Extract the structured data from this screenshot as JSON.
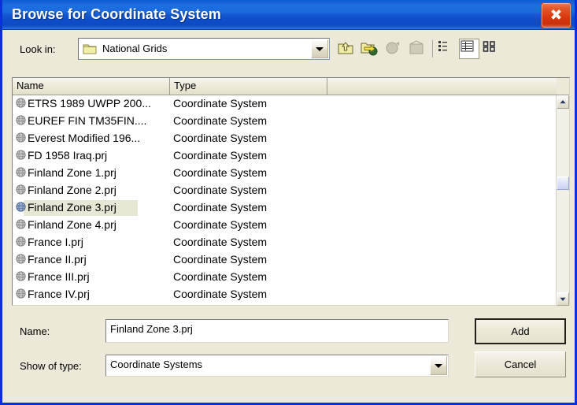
{
  "window": {
    "title": "Browse for Coordinate System",
    "close_label": "Close",
    "titlebar_color": "#1c6bdd",
    "dialog_bg": "#ece9d8",
    "border_color": "#0831d9",
    "close_button_color": "#d8370e"
  },
  "toolbar": {
    "lookin_label": "Look in:",
    "lookin_value": "National Grids",
    "buttons": [
      {
        "name": "up-one-level",
        "tooltip": "Up One Level",
        "enabled": true
      },
      {
        "name": "connect-to-folder",
        "tooltip": "Connect To Folder",
        "enabled": true
      },
      {
        "name": "disabled-tool-1",
        "tooltip": "",
        "enabled": false
      },
      {
        "name": "disabled-tool-2",
        "tooltip": "",
        "enabled": false
      }
    ],
    "view_buttons": [
      {
        "name": "list-view",
        "tooltip": "List",
        "active": false
      },
      {
        "name": "details-view",
        "tooltip": "Details",
        "active": true
      },
      {
        "name": "icons-view",
        "tooltip": "Large Icons",
        "active": false
      }
    ]
  },
  "file_list": {
    "columns": [
      "Name",
      "Type"
    ],
    "selected_index": 6,
    "rows": [
      {
        "name": "ETRS 1989 UWPP 200...",
        "type": "Coordinate System"
      },
      {
        "name": "EUREF FIN TM35FIN....",
        "type": "Coordinate System"
      },
      {
        "name": "Everest Modified 196...",
        "type": "Coordinate System"
      },
      {
        "name": "FD 1958 Iraq.prj",
        "type": "Coordinate System"
      },
      {
        "name": "Finland Zone 1.prj",
        "type": "Coordinate System"
      },
      {
        "name": "Finland Zone 2.prj",
        "type": "Coordinate System"
      },
      {
        "name": "Finland Zone 3.prj",
        "type": "Coordinate System"
      },
      {
        "name": "Finland Zone 4.prj",
        "type": "Coordinate System"
      },
      {
        "name": "France I.prj",
        "type": "Coordinate System"
      },
      {
        "name": "France II.prj",
        "type": "Coordinate System"
      },
      {
        "name": "France III.prj",
        "type": "Coordinate System"
      },
      {
        "name": "France IV.prj",
        "type": "Coordinate System"
      }
    ],
    "selection_color": "#e8e6d4"
  },
  "form": {
    "name_label": "Name:",
    "name_value": "Finland Zone 3.prj",
    "type_label": "Show of type:",
    "type_value": "Coordinate Systems"
  },
  "actions": {
    "add_label": "Add",
    "cancel_label": "Cancel"
  }
}
